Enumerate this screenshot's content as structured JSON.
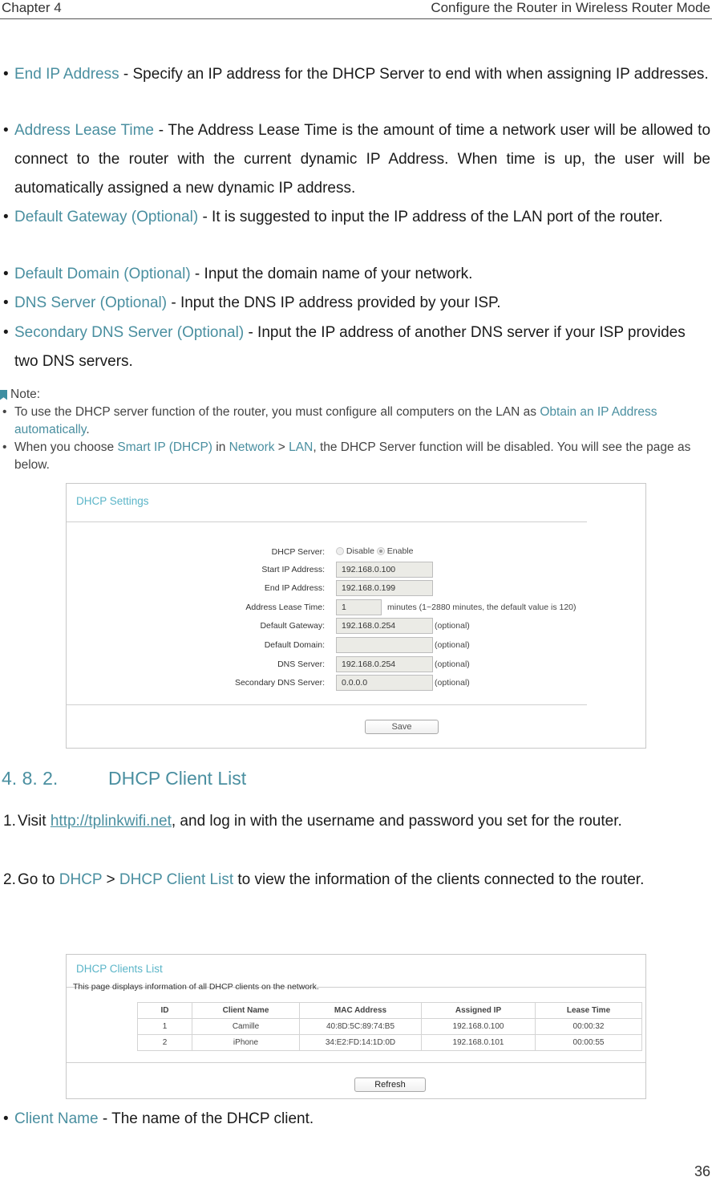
{
  "header": {
    "chapter": "Chapter 4",
    "title": "Configure the Router in Wireless Router Mode"
  },
  "bullets_top": [
    {
      "term": "End IP Address",
      "text": " - Specify an IP address for the DHCP Server to end with when assigning IP addresses."
    },
    {
      "term": "Address Lease Time",
      "text": " - The Address Lease Time is the amount of time a network user will be allowed to connect to the router with the current dynamic IP Address. When time is up, the user will be automatically assigned a new dynamic IP address."
    },
    {
      "term": "Default Gateway (Optional)",
      "text": " - It is suggested to input the IP address of the LAN port of the router."
    },
    {
      "term": "Default Domain (Optional)",
      "text": " - Input the domain name of your network."
    },
    {
      "term": "DNS Server (Optional)",
      "text": " - Input the DNS IP address provided by your ISP."
    },
    {
      "term": "Secondary DNS Server (Optional)",
      "text": " - Input the IP address of another DNS server if your ISP provides two DNS servers."
    }
  ],
  "note": {
    "title": "Note:",
    "item1": {
      "pre": "To use the DHCP server function of the router, you must configure all computers on the LAN as ",
      "link": "Obtain an IP Address automatically",
      "post": "."
    },
    "item2": {
      "pre": "When you choose ",
      "link1": "Smart IP (DHCP)",
      "mid1": " in ",
      "link2": "Network",
      "mid2": " > ",
      "link3": "LAN",
      "post": ", the DHCP Server function will be disabled. You will see the page as below."
    }
  },
  "dhcp_settings": {
    "title": "DHCP Settings",
    "server_label": "DHCP Server:",
    "disable_label": "Disable",
    "enable_label": "Enable",
    "selected": "Enable",
    "fields": [
      {
        "label": "Start IP Address:",
        "value": "192.168.0.100",
        "suffix": ""
      },
      {
        "label": "End IP Address:",
        "value": "192.168.0.199",
        "suffix": ""
      },
      {
        "label": "Address Lease Time:",
        "value": "1",
        "suffix": "minutes (1~2880 minutes, the default value is 120)"
      },
      {
        "label": "Default Gateway:",
        "value": "192.168.0.254",
        "suffix": "(optional)"
      },
      {
        "label": "Default Domain:",
        "value": "",
        "suffix": "(optional)"
      },
      {
        "label": "DNS Server:",
        "value": "192.168.0.254",
        "suffix": "(optional)"
      },
      {
        "label": "Secondary DNS Server:",
        "value": "0.0.0.0",
        "suffix": "(optional)"
      }
    ],
    "save_label": "Save"
  },
  "section": {
    "number": "4. 8. 2.",
    "title": "DHCP Client List"
  },
  "steps": [
    {
      "n": "1.",
      "pre": "Visit ",
      "link": "http://tplinkwifi.net",
      "post": ", and log in with the username and password you set for the router."
    },
    {
      "n": "2.",
      "pre": "Go to ",
      "link1": "DHCP",
      "mid": " > ",
      "link2": "DHCP Client List",
      "post": " to view the information of the clients connected to the router."
    }
  ],
  "client_list": {
    "title": "DHCP Clients List",
    "description": "This page displays information of all DHCP clients on the network.",
    "columns": [
      "ID",
      "Client Name",
      "MAC Address",
      "Assigned IP",
      "Lease Time"
    ],
    "rows": [
      [
        "1",
        "Camille",
        "40:8D:5C:89:74:B5",
        "192.168.0.100",
        "00:00:32"
      ],
      [
        "2",
        "iPhone",
        "34:E2:FD:14:1D:0D",
        "192.168.0.101",
        "00:00:55"
      ]
    ],
    "refresh_label": "Refresh"
  },
  "bullets_bottom": [
    {
      "term": "Client Name",
      "text": " - The name of the DHCP client."
    }
  ],
  "page_number": "36"
}
